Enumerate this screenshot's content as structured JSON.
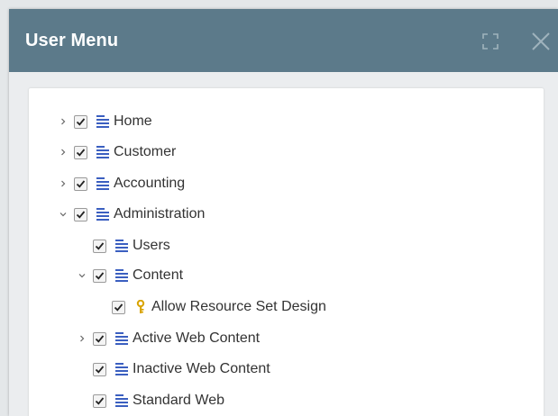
{
  "dialog": {
    "title": "User Menu"
  },
  "colors": {
    "titlebar": "#5c7a8a",
    "menu_icon": "#3b5fc0",
    "key_icon": "#d9a400"
  },
  "tree": [
    {
      "label": "Home",
      "toggle": "collapsed",
      "checked": true,
      "icon": "menu-lines-icon"
    },
    {
      "label": "Customer",
      "toggle": "collapsed",
      "checked": true,
      "icon": "menu-lines-icon"
    },
    {
      "label": "Accounting",
      "toggle": "collapsed",
      "checked": true,
      "icon": "menu-lines-icon"
    },
    {
      "label": "Administration",
      "toggle": "expanded",
      "checked": true,
      "icon": "menu-lines-icon"
    },
    {
      "label": "Users",
      "toggle": "none",
      "checked": true,
      "icon": "menu-lines-icon"
    },
    {
      "label": "Content",
      "toggle": "expanded",
      "checked": true,
      "icon": "menu-lines-icon"
    },
    {
      "label": "Allow Resource Set Design",
      "toggle": "none",
      "checked": true,
      "icon": "key-icon"
    },
    {
      "label": "Active Web Content",
      "toggle": "collapsed",
      "checked": true,
      "icon": "menu-lines-icon"
    },
    {
      "label": "Inactive Web Content",
      "toggle": "none",
      "checked": true,
      "icon": "menu-lines-icon"
    },
    {
      "label": "Standard Web",
      "toggle": "none",
      "checked": true,
      "icon": "menu-lines-icon"
    }
  ]
}
